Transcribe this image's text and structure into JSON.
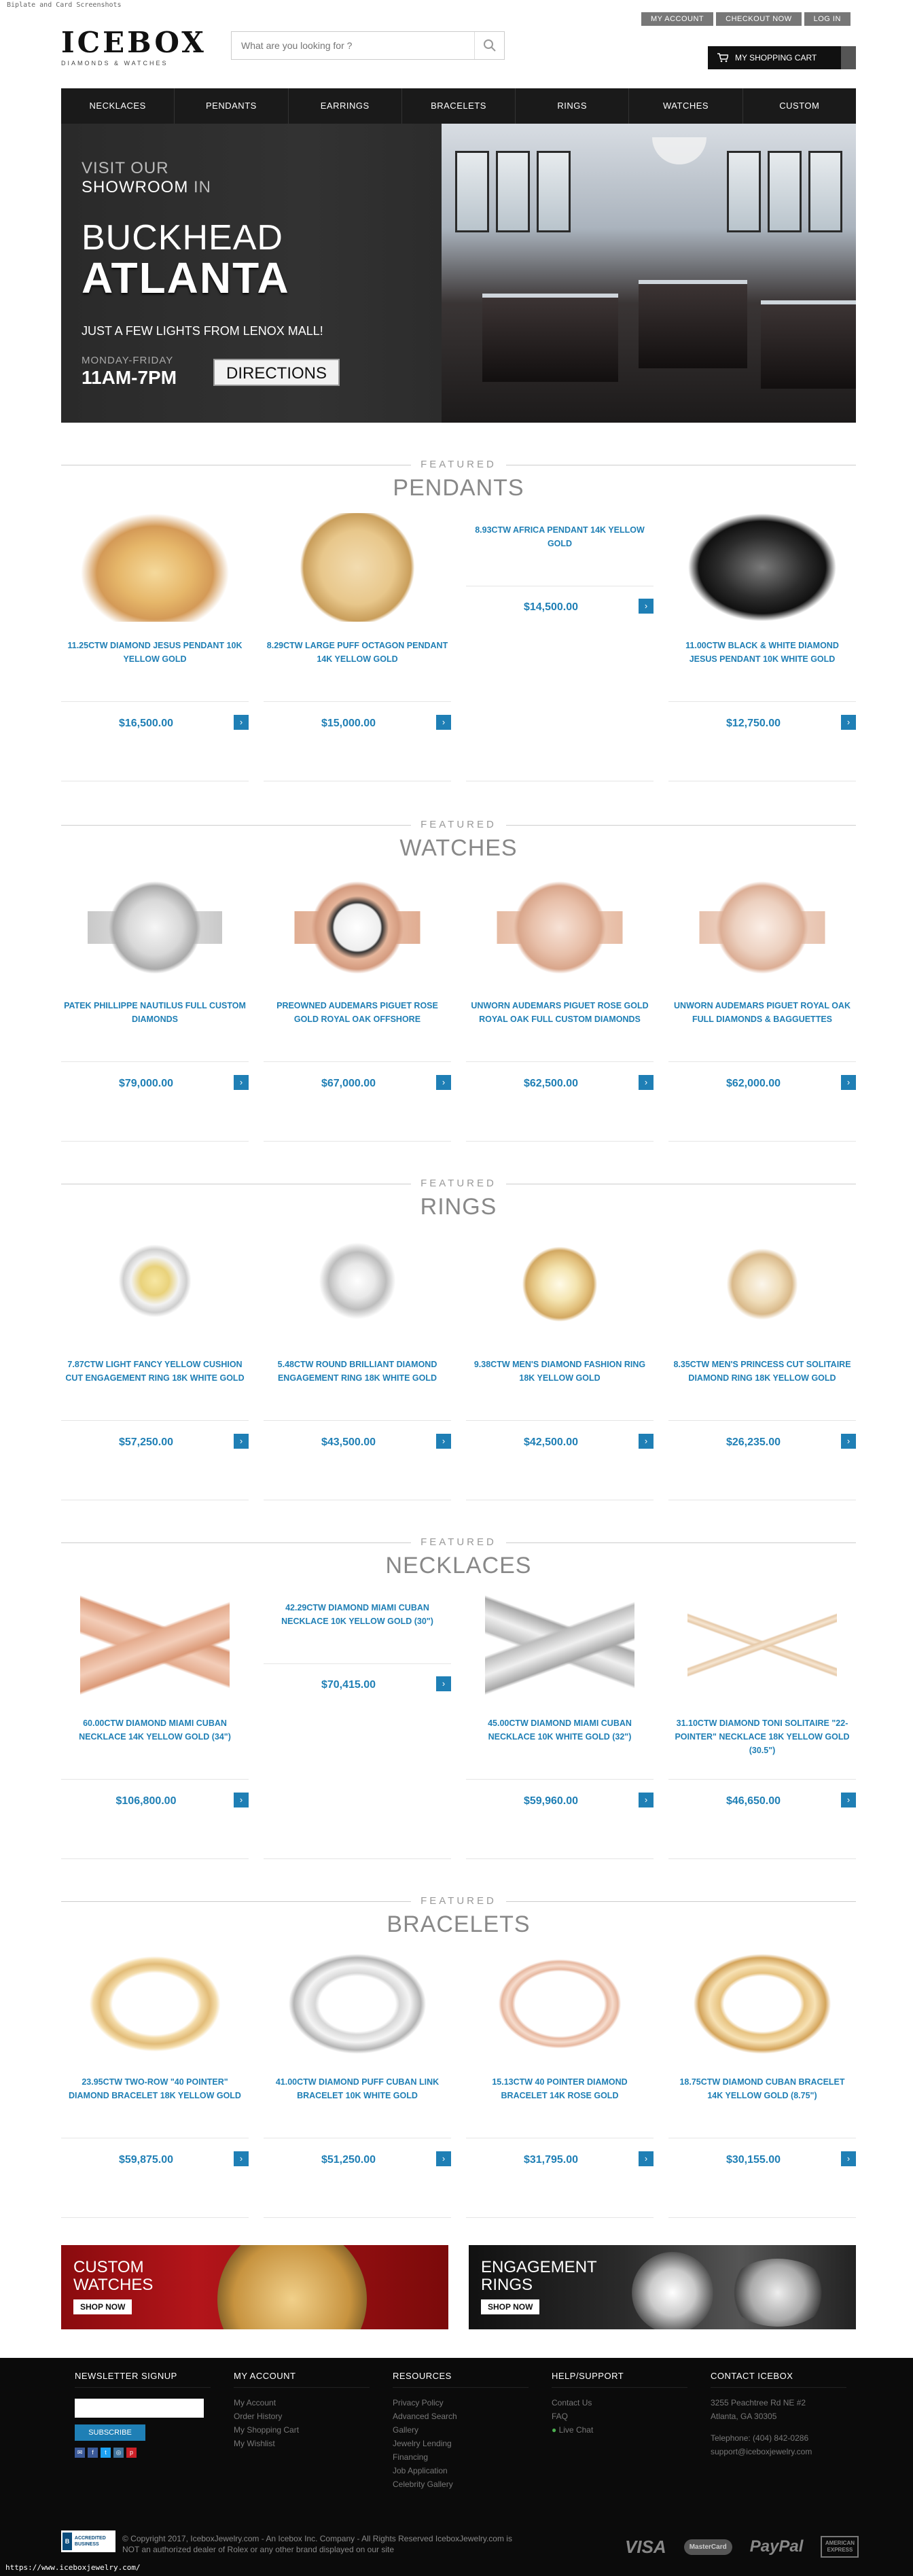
{
  "caption": "Biplate and Card Screenshots",
  "url": "https://www.iceboxjewelry.com/",
  "header": {
    "logo": "ICEBOX",
    "logo_sub": "DIAMONDS & WATCHES",
    "search_placeholder": "What are you looking for ?",
    "top_links": [
      "MY ACCOUNT",
      "CHECKOUT NOW",
      "LOG IN"
    ],
    "cart": "MY SHOPPING CART"
  },
  "nav": [
    "NECKLACES",
    "PENDANTS",
    "EARRINGS",
    "BRACELETS",
    "RINGS",
    "WATCHES",
    "CUSTOM"
  ],
  "hero": {
    "line1a": "VISIT OUR",
    "line1b": "SHOWROOM",
    "line1c": "IN",
    "city": "BUCKHEAD",
    "metro": "ATLANTA",
    "tagline": "JUST A FEW LIGHTS FROM LENOX MALL!",
    "days": "MONDAY-FRIDAY",
    "hours": "11AM-7PM",
    "directions": "DIRECTIONS"
  },
  "featured_label": "FEATURED",
  "sections": [
    {
      "name": "PENDANTS",
      "items": [
        {
          "title": "11.25CTW DIAMOND JESUS PENDANT 10K YELLOW GOLD",
          "price": "$16,500.00",
          "img": "pendant-gold-jesus"
        },
        {
          "title": "8.29CTW LARGE PUFF OCTAGON PENDANT 14K YELLOW GOLD",
          "price": "$15,000.00",
          "img": "pendant-octagon"
        },
        {
          "title": "8.93CTW AFRICA PENDANT 14K YELLOW GOLD",
          "price": "$14,500.00",
          "img": ""
        },
        {
          "title": "11.00CTW BLACK & WHITE DIAMOND JESUS PENDANT 10K WHITE GOLD",
          "price": "$12,750.00",
          "img": "pendant-black-jesus"
        }
      ]
    },
    {
      "name": "WATCHES",
      "items": [
        {
          "title": "PATEK PHILLIPPE NAUTILUS FULL CUSTOM DIAMONDS",
          "price": "$79,000.00",
          "img": "watch-silver"
        },
        {
          "title": "PREOWNED AUDEMARS PIGUET ROSE GOLD ROYAL OAK OFFSHORE",
          "price": "$67,000.00",
          "img": "watch-rose-offshore"
        },
        {
          "title": "UNWORN AUDEMARS PIGUET ROSE GOLD ROYAL OAK FULL CUSTOM DIAMONDS",
          "price": "$62,500.00",
          "img": "watch-rose"
        },
        {
          "title": "UNWORN AUDEMARS PIGUET ROYAL OAK FULL DIAMONDS & BAGGUETTES",
          "price": "$62,000.00",
          "img": "watch-rose2"
        }
      ]
    },
    {
      "name": "RINGS",
      "items": [
        {
          "title": "7.87CTW LIGHT FANCY YELLOW CUSHION CUT ENGAGEMENT RING 18K WHITE GOLD",
          "price": "$57,250.00",
          "img": "ring-yellow-cushion"
        },
        {
          "title": "5.48CTW ROUND BRILLIANT DIAMOND ENGAGEMENT RING 18K WHITE GOLD",
          "price": "$43,500.00",
          "img": "ring-round"
        },
        {
          "title": "9.38CTW MEN'S DIAMOND FASHION RING 18K YELLOW GOLD",
          "price": "$42,500.00",
          "img": "ring-mens"
        },
        {
          "title": "8.35CTW MEN'S PRINCESS CUT SOLITAIRE DIAMOND RING 18K YELLOW GOLD",
          "price": "$26,235.00",
          "img": "ring-princess"
        }
      ]
    },
    {
      "name": "NECKLACES",
      "items": [
        {
          "title": "60.00CTW DIAMOND MIAMI CUBAN NECKLACE 14K YELLOW GOLD (34\")",
          "price": "$106,800.00",
          "img": "chain-rose"
        },
        {
          "title": "42.29CTW DIAMOND MIAMI CUBAN NECKLACE 10K YELLOW GOLD (30\")",
          "price": "$70,415.00",
          "img": ""
        },
        {
          "title": "45.00CTW DIAMOND MIAMI CUBAN NECKLACE 10K WHITE GOLD (32\")",
          "price": "$59,960.00",
          "img": "chain-white"
        },
        {
          "title": "31.10CTW DIAMOND TONI SOLITAIRE \"22-POINTER\" NECKLACE 18K YELLOW GOLD (30.5\")",
          "price": "$46,650.00",
          "img": "chain-tennis"
        }
      ]
    },
    {
      "name": "BRACELETS",
      "items": [
        {
          "title": "23.95CTW TWO-ROW \"40 POINTER\" DIAMOND BRACELET 18K YELLOW GOLD",
          "price": "$59,875.00",
          "img": "bracelet-tworow"
        },
        {
          "title": "41.00CTW DIAMOND PUFF CUBAN LINK BRACELET 10K WHITE GOLD",
          "price": "$51,250.00",
          "img": "bracelet-cuban-white"
        },
        {
          "title": "15.13CTW 40 POINTER DIAMOND BRACELET 14K ROSE GOLD",
          "price": "$31,795.00",
          "img": "bracelet-rose"
        },
        {
          "title": "18.75CTW DIAMOND CUBAN BRACELET 14K YELLOW GOLD (8.75\")",
          "price": "$30,155.00",
          "img": "bracelet-cuban-yellow"
        }
      ]
    }
  ],
  "promos": [
    {
      "line1": "CUSTOM",
      "line2": "WATCHES",
      "button": "SHOP NOW"
    },
    {
      "line1": "ENGAGEMENT",
      "line2": "RINGS",
      "button": "SHOP NOW"
    }
  ],
  "footer": {
    "newsletter": "NEWSLETTER SIGNUP",
    "subscribe": "SUBSCRIBE",
    "account": {
      "title": "MY ACCOUNT",
      "links": [
        "My Account",
        "Order History",
        "My Shopping Cart",
        "My Wishlist"
      ]
    },
    "resources": {
      "title": "RESOURCES",
      "links": [
        "Privacy Policy",
        "Advanced Search",
        "Gallery",
        "Jewelry Lending",
        "Financing",
        "Job Application",
        "Celebrity Gallery"
      ]
    },
    "help": {
      "title": "HELP/SUPPORT",
      "links": [
        "Contact Us",
        "FAQ",
        "Live Chat"
      ]
    },
    "contact": {
      "title": "CONTACT ICEBOX",
      "lines": [
        "3255 Peachtree Rd NE #2",
        "Atlanta, GA 30305",
        "",
        "Telephone: (404) 842-0286",
        "support@iceboxjewelry.com"
      ]
    },
    "copyright1": "© Copyright 2017, IceboxJewelry.com - An Icebox Inc. Company - All Rights Reserved IceboxJewelry.com is",
    "copyright2": "NOT an authorized dealer of Rolex or any other brand displayed on our site",
    "bbb": "ACCREDITED BUSINESS",
    "payments": [
      "VISA",
      "MasterCard",
      "PayPal",
      "AMERICAN EXPRESS"
    ]
  },
  "colors": {
    "accent": "#1f7fb5",
    "nav_bg": "#1a1a1a",
    "footer_bg": "#0b0b0b"
  }
}
